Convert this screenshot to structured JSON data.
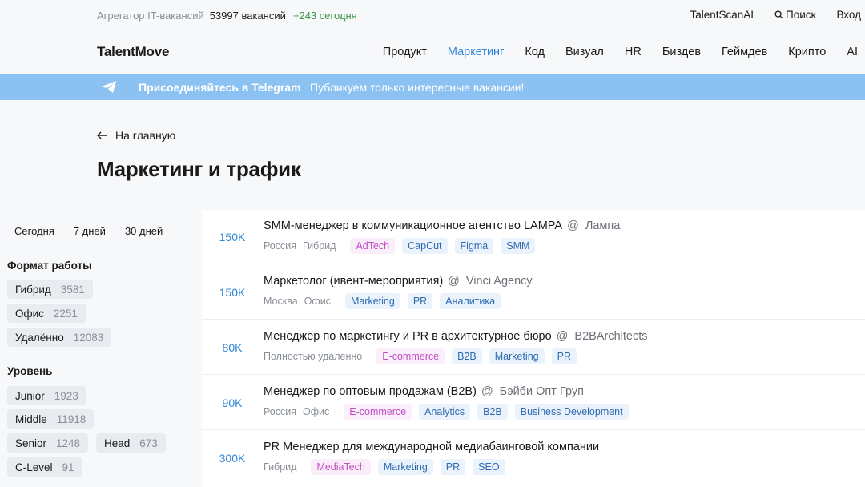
{
  "header": {
    "aggregator_label": "Агрегатор IT-вакансий",
    "vacancy_count": "53997 вакансий",
    "today_count": "+243 сегодня",
    "talentscan": "TalentScanAI",
    "search": "Поиск",
    "login": "Вход",
    "logo": "TalentMove",
    "nav": [
      "Продукт",
      "Маркетинг",
      "Код",
      "Визуал",
      "HR",
      "Биздев",
      "Геймдев",
      "Крипто",
      "AI"
    ],
    "active_nav": "Маркетинг"
  },
  "banner": {
    "join": "Присоединяйтесь в Telegram",
    "desc": "Публикуем только интересные вакансии!"
  },
  "page": {
    "back": "На главную",
    "title": "Маркетинг и трафик"
  },
  "filters": {
    "periods": [
      "Сегодня",
      "7 дней",
      "30 дней"
    ],
    "format_heading": "Формат работы",
    "format": [
      {
        "label": "Гибрид",
        "count": "3581"
      },
      {
        "label": "Офис",
        "count": "2251"
      },
      {
        "label": "Удалённо",
        "count": "12083"
      }
    ],
    "level_heading": "Уровень",
    "levels": [
      {
        "label": "Junior",
        "count": "1923"
      },
      {
        "label": "Middle",
        "count": "11918"
      },
      {
        "label": "Senior",
        "count": "1248"
      },
      {
        "label": "Head",
        "count": "673"
      },
      {
        "label": "C-Level",
        "count": "91"
      }
    ]
  },
  "jobs": [
    {
      "salary": "150K",
      "title": "SMM-менеджер в коммуникационное агентство LAMPA",
      "company": "Лампа",
      "locations": [
        "Россия",
        "Гибрид"
      ],
      "tags": [
        {
          "label": "AdTech",
          "color": "pink"
        },
        {
          "label": "CapCut",
          "color": "blue"
        },
        {
          "label": "Figma",
          "color": "blue"
        },
        {
          "label": "SMM",
          "color": "blue"
        }
      ]
    },
    {
      "salary": "150K",
      "title": "Маркетолог (ивент-мероприятия)",
      "company": "Vinci Agency",
      "locations": [
        "Москва",
        "Офис"
      ],
      "tags": [
        {
          "label": "Marketing",
          "color": "blue"
        },
        {
          "label": "PR",
          "color": "blue"
        },
        {
          "label": "Аналитика",
          "color": "blue"
        }
      ]
    },
    {
      "salary": "80K",
      "title": "Менеджер по маркетингу и PR в архитектурное бюро",
      "company": "B2BArchitects",
      "locations": [
        "Полностью удаленно"
      ],
      "tags": [
        {
          "label": "E-commerce",
          "color": "pink"
        },
        {
          "label": "B2B",
          "color": "blue"
        },
        {
          "label": "Marketing",
          "color": "blue"
        },
        {
          "label": "PR",
          "color": "blue"
        }
      ]
    },
    {
      "salary": "90K",
      "title": "Менеджер по оптовым продажам (B2B)",
      "company": "Бэйби Опт Груп",
      "locations": [
        "Россия",
        "Офис"
      ],
      "tags": [
        {
          "label": "E-commerce",
          "color": "pink"
        },
        {
          "label": "Analytics",
          "color": "blue"
        },
        {
          "label": "B2B",
          "color": "blue"
        },
        {
          "label": "Business Development",
          "color": "blue"
        }
      ]
    },
    {
      "salary": "300K",
      "title": "PR Менеджер для международной медиабаинговой компании",
      "company": "",
      "locations": [
        "Гибрид"
      ],
      "tags": [
        {
          "label": "MediaTech",
          "color": "pink"
        },
        {
          "label": "Marketing",
          "color": "blue"
        },
        {
          "label": "PR",
          "color": "blue"
        },
        {
          "label": "SEO",
          "color": "blue"
        }
      ]
    }
  ],
  "colors": {
    "accent": "#2f86d6",
    "banner": "#8cc2f2",
    "pink_tag": "#c14ec2",
    "green": "#3a9a4a"
  }
}
